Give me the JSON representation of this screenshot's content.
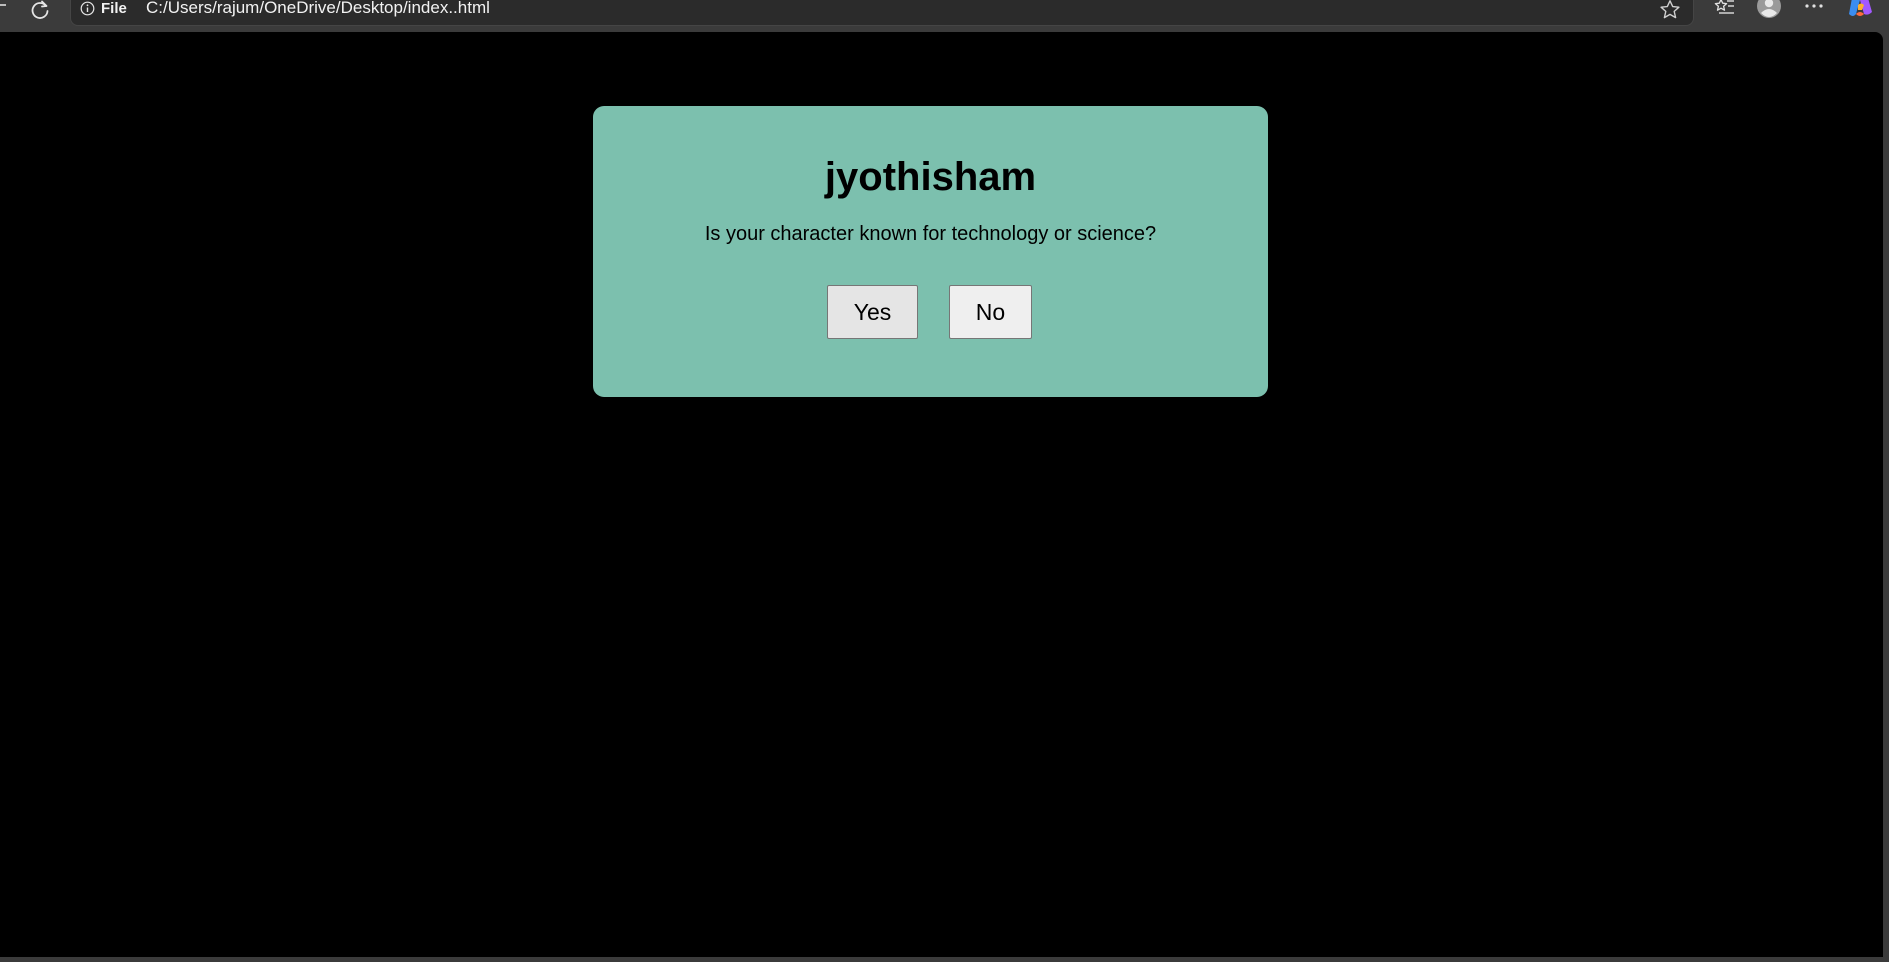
{
  "browser": {
    "site_info_label": "File",
    "url": "C:/Users/rajum/OneDrive/Desktop/index..html",
    "icons": {
      "reload": "reload-icon",
      "info": "info-icon",
      "favorite": "star-icon",
      "favorites_list": "favorites-icon",
      "profile": "profile-icon",
      "more": "more-icon",
      "copilot": "copilot-icon"
    }
  },
  "page": {
    "background": "#000000",
    "card": {
      "background": "#7cc0ae",
      "title": "jyothisham",
      "question": "Is your character known for technology or science?",
      "yes_label": "Yes",
      "no_label": "No"
    }
  }
}
